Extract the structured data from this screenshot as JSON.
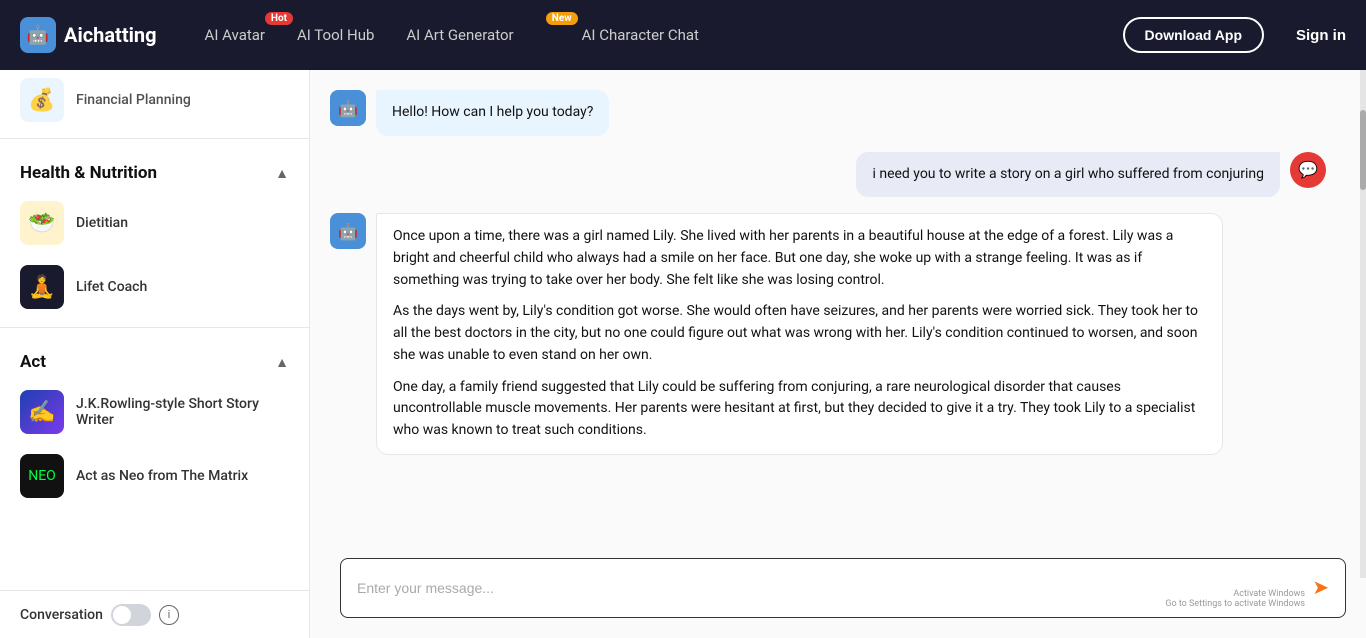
{
  "navbar": {
    "brand_name": "Aichatting",
    "nav_items": [
      {
        "label": "AI Avatar",
        "badge": "Hot",
        "badge_type": "hot"
      },
      {
        "label": "AI Tool Hub",
        "badge": null
      },
      {
        "label": "AI Art Generator",
        "badge": "New",
        "badge_type": "new"
      },
      {
        "label": "AI Character Chat",
        "badge": null
      }
    ],
    "download_label": "Download App",
    "signin_label": "Sign in"
  },
  "sidebar": {
    "financial_planning_label": "Financial Planning",
    "section_health": "Health & Nutrition",
    "dietitian_label": "Dietitian",
    "lifet_label": "Lifet Coach",
    "section_act": "Act",
    "rowling_label": "J.K.Rowling-style Short Story Writer",
    "neo_label": "Act as Neo from The Matrix",
    "conversation_label": "Conversation"
  },
  "chat": {
    "greeting": "Hello! How can I help you today?",
    "user_message": "i need you to write a story on a girl who suffered from conjuring",
    "bot_story_p1": "Once upon a time, there was a girl named Lily. She lived with her parents in a beautiful house at the edge of a forest. Lily was a bright and cheerful child who always had a smile on her face. But one day, she woke up with a strange feeling. It was as if something was trying to take over her body. She felt like she was losing control.",
    "bot_story_p2": "As the days went by, Lily's condition got worse. She would often have seizures, and her parents were worried sick. They took her to all the best doctors in the city, but no one could figure out what was wrong with her. Lily's condition continued to worsen, and soon she was unable to even stand on her own.",
    "bot_story_p3": "One day, a family friend suggested that Lily could be suffering from conjuring, a rare neurological disorder that causes uncontrollable muscle movements. Her parents were hesitant at first, but they decided to give it a try. They took Lily to a specialist who was known to treat such conditions.",
    "input_placeholder": "Enter your message...",
    "windows_line1": "Activate Windows",
    "windows_line2": "Go to Settings to activate Windows"
  }
}
